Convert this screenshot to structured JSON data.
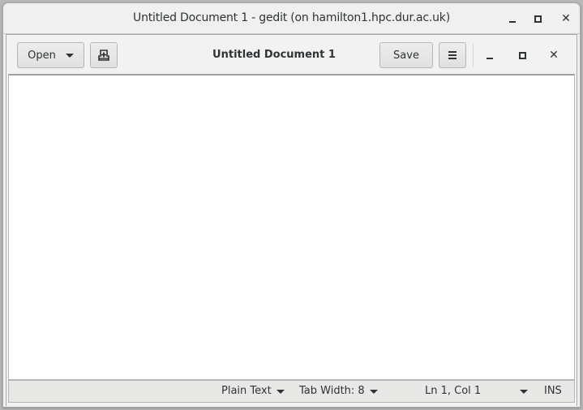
{
  "window": {
    "title": "Untitled Document 1 - gedit (on hamilton1.hpc.dur.ac.uk)",
    "controls": {
      "minimize": "minimize-icon",
      "maximize": "maximize-icon",
      "close": "close-icon",
      "close_glyph": "✕"
    }
  },
  "headerbar": {
    "open_label": "Open",
    "new_tab_icon": "new-document-icon",
    "title": "Untitled Document 1",
    "save_label": "Save",
    "menu_icon": "hamburger-menu-icon",
    "close_glyph": "✕"
  },
  "editor": {
    "content": ""
  },
  "statusbar": {
    "language": "Plain Text",
    "tab_width": "Tab Width: 8",
    "cursor_position": "Ln 1, Col 1",
    "insert_mode": "INS"
  }
}
